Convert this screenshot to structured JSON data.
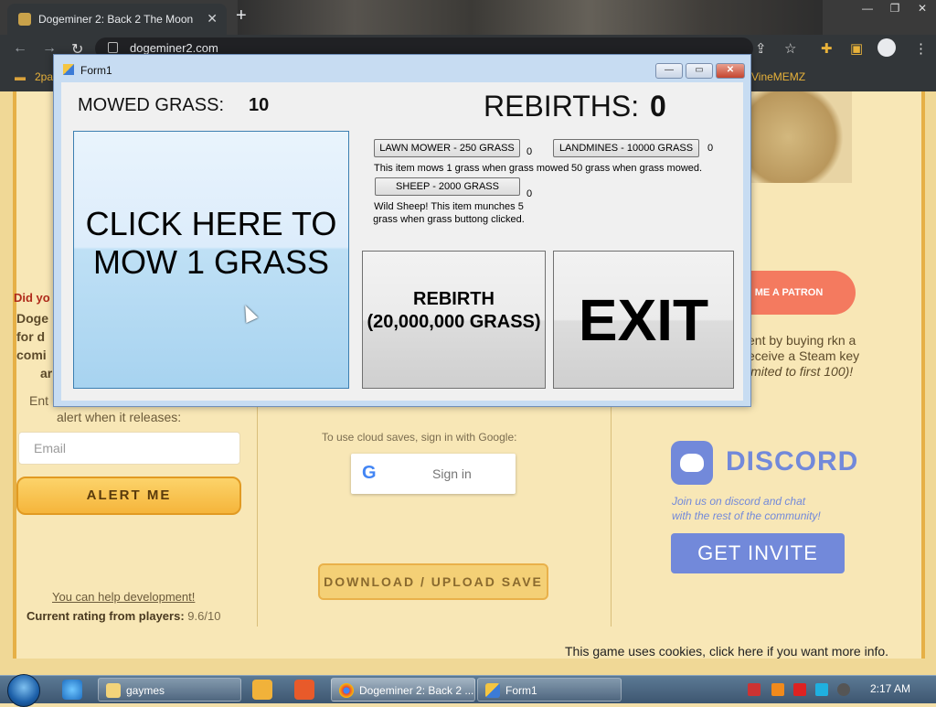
{
  "browser": {
    "tab_title": "Dogeminer 2: Back 2 The Moon",
    "tab_close": "✕",
    "new_tab": "+",
    "win_buttons": [
      "—",
      "❐",
      "✕"
    ],
    "url": "dogeminer2.com",
    "bookmarks": [
      "2pa",
      "VineMEMZ"
    ]
  },
  "site": {
    "did_you": "Did yo",
    "doge_lines": [
      "Doge",
      "for d",
      "comi",
      "ar"
    ],
    "alert_label": "alert when it releases:",
    "alert_label_prefix": "Ent",
    "email_placeholder": "Email",
    "alert_button": "ALERT ME",
    "help_link": "You can help development!",
    "rating_label": "Current rating from players:",
    "rating_value": "9.6/10",
    "cloud_text": "To use cloud saves, sign in with Google:",
    "google_g": "G",
    "sign_in": "Sign in",
    "download_button": "DOWNLOAD / UPLOAD SAVE",
    "patron_button": "ME A PATRON",
    "support_lines": [
      "ent by buying rkn a",
      "eceive a Steam key",
      "imited to first 100)!"
    ],
    "discord_word": "DISCORD",
    "discord_sub": [
      "Join us on discord and chat",
      "with the rest of the community!"
    ],
    "invite_button": "GET INVITE",
    "cookie_text": "This game uses cookies, click here if you want more info."
  },
  "form": {
    "title": "Form1",
    "controls": [
      "—",
      "▭",
      "✕"
    ],
    "mowed_label": "MOWED GRASS:",
    "mowed_value": "10",
    "rebirths_label": "REBIRTHS:",
    "rebirths_value": "0",
    "mow_button": "CLICK HERE TO MOW 1 GRASS",
    "shop": [
      {
        "label": "LAWN MOWER - 250 GRASS",
        "count": "0",
        "desc": "This item mows 1 grass when grass mowed"
      },
      {
        "label": "LANDMINES - 10000 GRASS",
        "count": "0",
        "desc": "50 grass when grass mowed."
      },
      {
        "label": "SHEEP - 2000 GRASS",
        "count": "0",
        "desc": "Wild Sheep! This item munches 5 grass when grass buttong clicked."
      }
    ],
    "rebirth_button": "REBIRTH (20,000,000 GRASS)",
    "exit_button": "EXIT"
  },
  "taskbar": {
    "items": [
      "gaymes",
      "Dogeminer 2: Back 2 ...",
      "Form1"
    ],
    "clock": "2:17 AM"
  },
  "colors": {
    "site_bg": "#f8e7b6",
    "accent_orange": "#f5b53b",
    "discord": "#7289da",
    "patron": "#f47a5f"
  }
}
